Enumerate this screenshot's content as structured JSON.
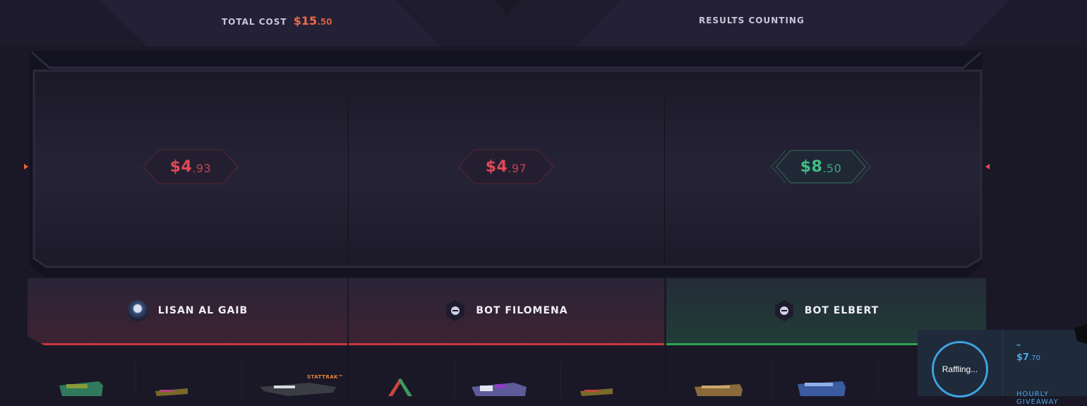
{
  "header": {
    "total_cost_label": "TOTAL COST",
    "total_cost_dollars": "$15",
    "total_cost_cents": ".50",
    "results_label": "RESULTS COUNTING"
  },
  "columns": [
    {
      "price_dollars": "$4",
      "price_cents": ".93",
      "status": "lose",
      "player": "LISAN AL GAIB",
      "avatar": "user-avatar"
    },
    {
      "price_dollars": "$4",
      "price_cents": ".97",
      "status": "lose",
      "player": "BOT FILOMENA",
      "avatar": "bot-icon"
    },
    {
      "price_dollars": "$8",
      "price_cents": ".50",
      "status": "win",
      "player": "BOT ELBERT",
      "avatar": "bot-icon"
    }
  ],
  "items": {
    "stattrak_label": "STATTRAK™"
  },
  "raffle": {
    "status": "Raffling...",
    "dash": "–",
    "price_dollars": "$7",
    "price_cents": ".70",
    "label": "HOURLY GIVEAWAY"
  },
  "colors": {
    "lose": "#e04956",
    "win": "#3fbf85",
    "accent_orange": "#ec6b4c",
    "raffle_blue": "#3ea3e0"
  }
}
